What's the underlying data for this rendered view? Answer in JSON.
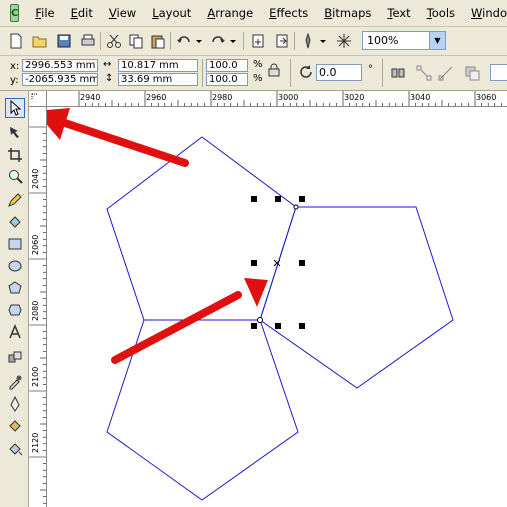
{
  "menu": {
    "items": [
      {
        "label": "File"
      },
      {
        "label": "Edit"
      },
      {
        "label": "View"
      },
      {
        "label": "Layout"
      },
      {
        "label": "Arrange"
      },
      {
        "label": "Effects"
      },
      {
        "label": "Bitmaps"
      },
      {
        "label": "Text"
      },
      {
        "label": "Tools"
      },
      {
        "label": "Window"
      }
    ]
  },
  "toolbar": {
    "zoom_value": "100%"
  },
  "property_bar": {
    "x_label": "x:",
    "x_value": "2996.553 mm",
    "y_label": "y:",
    "y_value": "-2065.935 mm",
    "width_value": "10.817 mm",
    "height_value": "33.69 mm",
    "scale_x": "100.0",
    "scale_y": "100.0",
    "percent_symbol_1": "%",
    "percent_symbol_2": "%",
    "rotation_value": "0.0",
    "degree_symbol": "°"
  },
  "ruler": {
    "h_labels": [
      "2940",
      "2960",
      "2980",
      "3000",
      "3020",
      "3040",
      "3060"
    ],
    "v_labels": [
      "2040",
      "2060",
      "2080",
      "2100",
      "2120"
    ]
  },
  "colors": {
    "shape_stroke": "#1a1acc",
    "arrow": "#e11010",
    "chrome": "#ece9d8",
    "handle": "#000000"
  },
  "tools": [
    "pick-tool",
    "shape-tool",
    "crop-tool",
    "zoom-tool",
    "freehand-tool",
    "smart-fill-tool",
    "rectangle-tool",
    "ellipse-tool",
    "polygon-tool",
    "spiral-tool",
    "text-tool",
    "interactive-blend-tool",
    "eyedropper-tool",
    "outline-tool",
    "fill-tool",
    "interactive-fill-tool"
  ]
}
